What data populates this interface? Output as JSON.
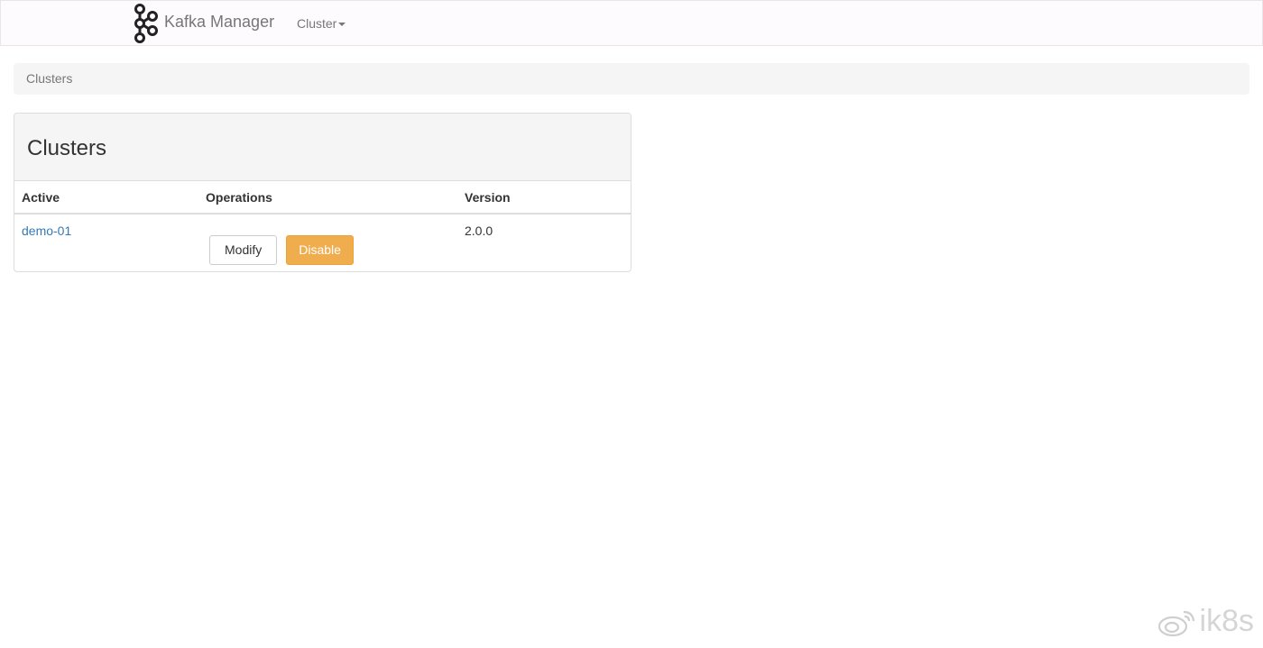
{
  "navbar": {
    "brand": "Kafka Manager",
    "menu_cluster": "Cluster"
  },
  "breadcrumb": "Clusters",
  "panel": {
    "title": "Clusters",
    "table": {
      "headers": [
        "Active",
        "Operations",
        "Version"
      ],
      "rows": [
        {
          "name": "demo-01",
          "modify_label": "Modify",
          "disable_label": "Disable",
          "version": "2.0.0"
        }
      ]
    }
  },
  "watermark": {
    "text": "ik8s",
    "icon": "weibo-icon"
  },
  "colors": {
    "link": "#337ab7",
    "warning": "#f0ad4e",
    "navbar_bg": "#fefbfe",
    "breadcrumb_bg": "#f5f5f5"
  }
}
